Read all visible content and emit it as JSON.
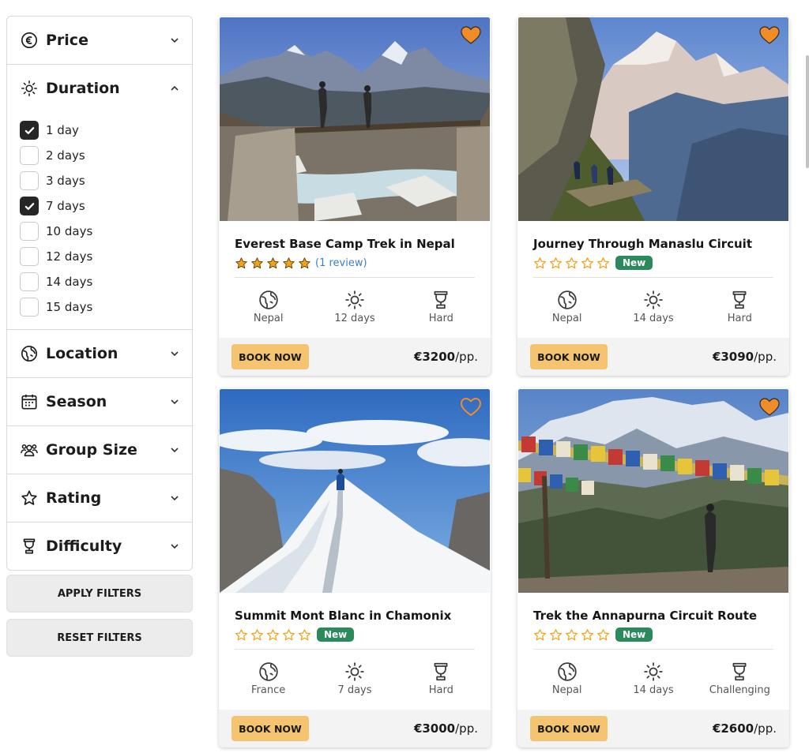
{
  "filters": {
    "sections": [
      {
        "id": "price",
        "label": "Price",
        "icon": "euro-icon",
        "expanded": false
      },
      {
        "id": "duration",
        "label": "Duration",
        "icon": "sun-icon",
        "expanded": true,
        "options": [
          {
            "label": "1 day",
            "checked": true
          },
          {
            "label": "2 days",
            "checked": false
          },
          {
            "label": "3 days",
            "checked": false
          },
          {
            "label": "7 days",
            "checked": true
          },
          {
            "label": "10 days",
            "checked": false
          },
          {
            "label": "12 days",
            "checked": false
          },
          {
            "label": "14 days",
            "checked": false
          },
          {
            "label": "15 days",
            "checked": false
          }
        ]
      },
      {
        "id": "location",
        "label": "Location",
        "icon": "globe-icon",
        "expanded": false
      },
      {
        "id": "season",
        "label": "Season",
        "icon": "calendar-icon",
        "expanded": false
      },
      {
        "id": "group",
        "label": "Group Size",
        "icon": "group-icon",
        "expanded": false
      },
      {
        "id": "rating",
        "label": "Rating",
        "icon": "star-icon",
        "expanded": false
      },
      {
        "id": "difficulty",
        "label": "Difficulty",
        "icon": "trophy-icon",
        "expanded": false
      }
    ],
    "apply_label": "APPLY FILTERS",
    "reset_label": "RESET FILTERS"
  },
  "colors": {
    "accent_heart": "#f08c2a",
    "star": "#f2a31b",
    "badge_new": "#2a8a5c",
    "book_button": "#f4c471",
    "review_link": "#3b7fc4"
  },
  "trips": [
    {
      "title": "Everest Base Camp Trek in Nepal",
      "stars": 5,
      "review_text": "(1 review)",
      "badge": "",
      "location": "Nepal",
      "duration": "12 days",
      "difficulty": "Hard",
      "book_label": "BOOK NOW",
      "price": "€3200",
      "price_unit": "/pp.",
      "favorited": true,
      "photo": "bridge-trekkers-photo"
    },
    {
      "title": "Journey Through Manaslu Circuit",
      "stars": 0,
      "review_text": "",
      "badge": "New",
      "location": "Nepal",
      "duration": "14 days",
      "difficulty": "Hard",
      "book_label": "BOOK NOW",
      "price": "€3090",
      "price_unit": "/pp.",
      "favorited": true,
      "photo": "mountain-trail-photo"
    },
    {
      "title": "Summit Mont Blanc in Chamonix",
      "stars": 0,
      "review_text": "",
      "badge": "New",
      "location": "France",
      "duration": "7 days",
      "difficulty": "Hard",
      "book_label": "BOOK NOW",
      "price": "€3000",
      "price_unit": "/pp.",
      "favorited": false,
      "photo": "snow-ridge-photo"
    },
    {
      "title": "Trek the Annapurna Circuit Route",
      "stars": 0,
      "review_text": "",
      "badge": "New",
      "location": "Nepal",
      "duration": "14 days",
      "difficulty": "Challenging",
      "book_label": "BOOK NOW",
      "price": "€2600",
      "price_unit": "/pp.",
      "favorited": true,
      "photo": "prayer-flags-photo"
    }
  ]
}
